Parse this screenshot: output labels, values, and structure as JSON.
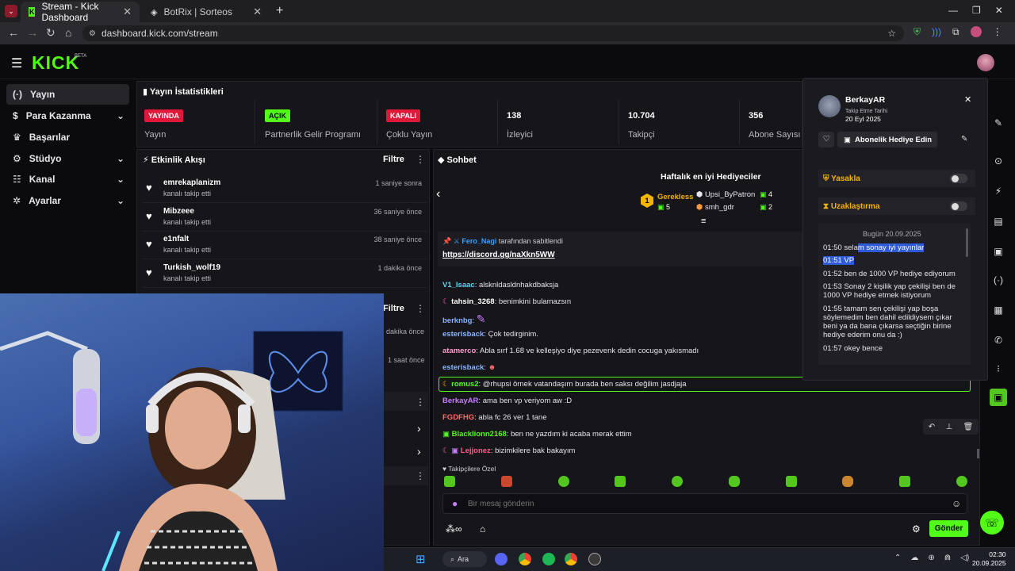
{
  "browser": {
    "tabs": [
      {
        "title": "Stream - Kick Dashboard"
      },
      {
        "title": "BotRix | Sorteos"
      }
    ],
    "url": "dashboard.kick.com/stream",
    "new_tab": "+"
  },
  "header": {
    "logo": "KICK",
    "beta": "BETA"
  },
  "sidebar": {
    "items": [
      {
        "label": "Yayın",
        "icon": "broadcast-icon"
      },
      {
        "label": "Para Kazanma",
        "icon": "dollar-icon"
      },
      {
        "label": "Başarılar",
        "icon": "trophy-icon"
      },
      {
        "label": "Stüdyo",
        "icon": "gear-icon"
      },
      {
        "label": "Kanal",
        "icon": "users-icon"
      },
      {
        "label": "Ayarlar",
        "icon": "cog-icon"
      }
    ]
  },
  "stats": {
    "title": "Yayın İstatistikleri",
    "cards": [
      {
        "badge": "YAYINDA",
        "label": "Yayın"
      },
      {
        "badge": "AÇIK",
        "label": "Partnerlik Gelir Programı"
      },
      {
        "badge": "KAPALI",
        "label": "Çoklu Yayın"
      },
      {
        "value": "138",
        "label": "İzleyici"
      },
      {
        "value": "10.704",
        "label": "Takipçi"
      },
      {
        "value": "356",
        "label": "Abone Sayısı"
      }
    ],
    "colors": {
      "live": "#e0193b",
      "on": "#53fc18",
      "off": "#e0193b"
    }
  },
  "activity": {
    "title": "Etkinlik Akışı",
    "filter": "Filtre",
    "events": [
      {
        "name": "emrekaplanizm",
        "sub": "kanalı takip etti",
        "time": "1 saniye sonra"
      },
      {
        "name": "Mibzeee",
        "sub": "kanalı takip etti",
        "time": "36 saniye önce"
      },
      {
        "name": "e1nfalt",
        "sub": "kanalı takip etti",
        "time": "38 saniye önce"
      },
      {
        "name": "Turkish_wolf19",
        "sub": "kanalı takip etti",
        "time": "1 dakika önce"
      }
    ],
    "filter2": "Filtre",
    "time_partial1": "dakika önce",
    "time_partial2": "1 saat önce"
  },
  "chat": {
    "title": "Sohbet",
    "gifters_title": "Haftalık en iyi Hediyeciler",
    "gifters": [
      {
        "name": "Gerekless",
        "count": "5",
        "rank": "1"
      },
      {
        "name": "Upsi_ByPatron",
        "count": "4"
      },
      {
        "name": "smh_gdr",
        "count": "2"
      }
    ],
    "pinned": {
      "by": "Fero_Nagi",
      "text": "tarafından sabitlendi",
      "link": "https://discord.gg/naXkn5WW"
    },
    "messages": [
      {
        "user": "V1_Isaac",
        "color": "#5fd3f3",
        "text": "alsknldasldnhakdbaksja"
      },
      {
        "user": "tahsin_3268",
        "color": "#ffffff",
        "text": "benimkini bulamazsın"
      },
      {
        "user": "berknbg",
        "color": "#8ab4ff",
        "text": ""
      },
      {
        "user": "esterisback",
        "color": "#8ab4ff",
        "text": "Çok tedirginim."
      },
      {
        "user": "atamerco",
        "color": "#ff9bd0",
        "text": "Abla sırf 1.68 ve kelleşiyo diye pezevenk dedin cocuga yakısmadı"
      },
      {
        "user": "esterisback",
        "color": "#8ab4ff",
        "text": ""
      },
      {
        "user": "romus2",
        "color": "#53fc18",
        "text": "@rhupsi örnek vatandaşım burada ben saksı değilim jasdjaja"
      },
      {
        "user": "BerkayAR",
        "color": "#c77dff",
        "text": "ama ben vp veriyom aw :D"
      },
      {
        "user": "FGDFHG",
        "color": "#ff6b6b",
        "text": "abla fc 26 ver 1 tane"
      },
      {
        "user": "Blacklionn2168",
        "color": "#53fc18",
        "text": "ben ne yazdım ki acaba merak ettim"
      },
      {
        "user": "Lejjonez",
        "color": "#ff5c8a",
        "text": "bizimkilere bak bakayım"
      }
    ],
    "emote_tab": "Takipçilere Özel",
    "input_placeholder": "Bir mesaj gönderin",
    "send": "Gönder"
  },
  "popup": {
    "user": "BerkayAR",
    "follow_label": "Takip Etme Tarihi",
    "follow_date": "20 Eyl 2025",
    "gift_sub": "Abonelik Hediye Edin",
    "ban": "Yasakla",
    "timeout": "Uzaklaştırma",
    "date_sep": "Bugün 20.09.2025",
    "messages": [
      {
        "time": "01:50",
        "pre": "sela",
        "hl": "m sonay iyi yayınlar"
      },
      {
        "time": "01:51",
        "pre": "",
        "hl": "VP"
      },
      {
        "time": "01:52",
        "pre": "ben de 1000 VP hediye ediyorum",
        "hl": ""
      },
      {
        "time": "01:53",
        "pre": "Sonay 2 kişilik yap çekilişi ben de 1000 VP hediye etmek istiyorum",
        "hl": ""
      },
      {
        "time": "01:55",
        "pre": "tamam sen çekilişi yap boşa söylemedim ben dahil edildiysem çıkar beni ya da bana çıkarsa seçtiğin birine hediye ederim onu da :)",
        "hl": ""
      },
      {
        "time": "01:57",
        "pre": "okey bence",
        "hl": ""
      }
    ]
  },
  "taskbar": {
    "search": "Ara",
    "time": "02:30",
    "date": "20.09.2025"
  }
}
